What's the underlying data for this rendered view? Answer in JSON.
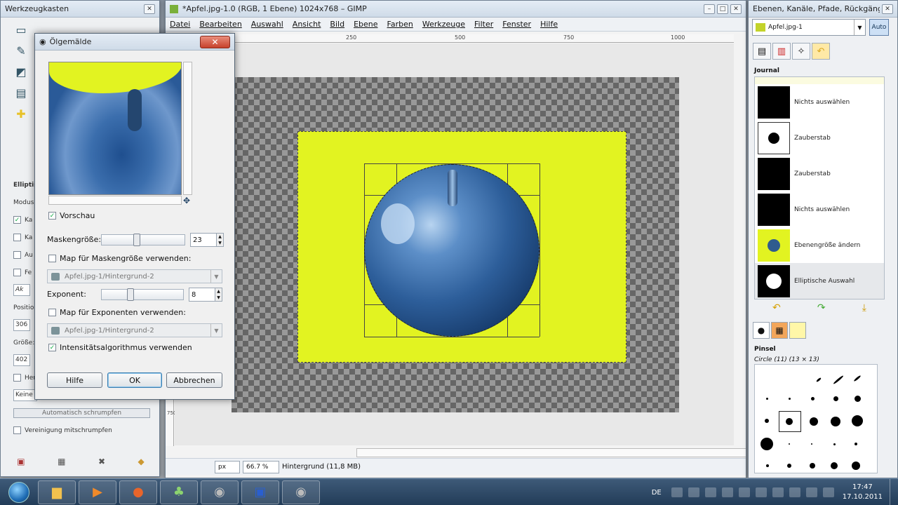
{
  "toolbox": {
    "title": "Werkzeugkasten",
    "section_label": "Elliptis",
    "modus_label": "Modus",
    "rows": [
      "Ka",
      "Ka",
      "Au",
      "Fe"
    ],
    "style_value": "Ak",
    "position_label": "Position",
    "position_value": "306",
    "size_label": "Größe:",
    "size_value": "402",
    "highlight_label": "Her",
    "combo_value": "Keine",
    "shrink_button": "Automatisch schrumpfen",
    "merge_label": "Vereinigung mitschrumpfen"
  },
  "main": {
    "title": "*Apfel.jpg-1.0 (RGB, 1 Ebene) 1024x768 – GIMP",
    "menu": [
      "Datei",
      "Bearbeiten",
      "Auswahl",
      "Ansicht",
      "Bild",
      "Ebene",
      "Farben",
      "Werkzeuge",
      "Filter",
      "Fenster",
      "Hilfe"
    ],
    "ruler_marks": [
      "250",
      "500",
      "750",
      "1000"
    ],
    "vruler_mark": "750",
    "unit": "px",
    "zoom": "66.7 %",
    "status": "Hintergrund (11,8 MB)"
  },
  "dock": {
    "title": "Ebenen, Kanäle, Pfade, Rückgängi...",
    "image_select": "Apfel.jpg-1",
    "auto_label": "Auto",
    "journal_title": "Journal",
    "journal_items": [
      {
        "label": "Nichts auswählen",
        "thumb": "full"
      },
      {
        "label": "Zauberstab",
        "thumb": "dot"
      },
      {
        "label": "Zauberstab",
        "thumb": "full"
      },
      {
        "label": "Nichts auswählen",
        "thumb": "full"
      },
      {
        "label": "Ebenengröße ändern",
        "thumb": "yellow"
      },
      {
        "label": "Elliptische Auswahl",
        "thumb": "big-dot"
      }
    ],
    "brush_title": "Pinsel",
    "brush_name": "Circle (11) (13 × 13)"
  },
  "dialog": {
    "title": "Ölgemälde",
    "preview_label": "Vorschau",
    "mask_size_label": "Maskengröße:",
    "mask_size_value": "23",
    "mask_size_fraction": 0.42,
    "map_mask_label": "Map für Maskengröße verwenden:",
    "map_mask_combo": "Apfel.jpg-1/Hintergrund-2",
    "exponent_label": "Exponent:",
    "exponent_value": "8",
    "exponent_fraction": 0.34,
    "map_exp_label": "Map für Exponenten verwenden:",
    "map_exp_combo": "Apfel.jpg-1/Hintergrund-2",
    "intensity_label": "Intensitätsalgorithmus verwenden",
    "buttons": {
      "help": "Hilfe",
      "ok": "OK",
      "cancel": "Abbrechen"
    }
  },
  "taskbar": {
    "lang": "DE",
    "time": "17:47",
    "date": "17.10.2011"
  }
}
